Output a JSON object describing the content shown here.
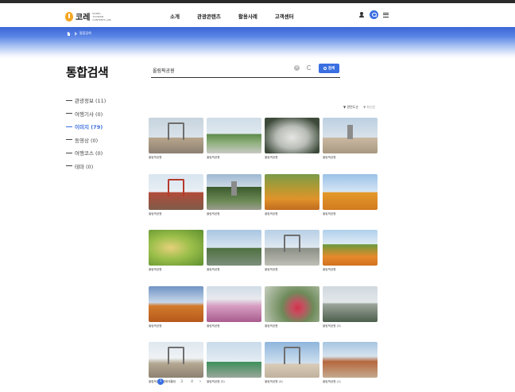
{
  "header": {
    "logo_text": "코레",
    "logo_sub": "KOREA TOURISM CONTENTS LAB",
    "nav": [
      "소개",
      "관광콘텐츠",
      "활용사례",
      "고객센터"
    ]
  },
  "breadcrumb": {
    "current": "통합검색"
  },
  "page_title": "통합검색",
  "search": {
    "value": "올림픽공원",
    "button_label": "검색"
  },
  "sidebar": {
    "items": [
      {
        "label": "관광정보 (11)",
        "active": false
      },
      {
        "label": "여행기사 (0)",
        "active": false
      },
      {
        "label": "이미지 (79)",
        "active": true
      },
      {
        "label": "동영상 (0)",
        "active": false
      },
      {
        "label": "여행코스 (0)",
        "active": false
      },
      {
        "label": "테마 (0)",
        "active": false
      }
    ]
  },
  "sort": {
    "primary": "▼ 관련도순",
    "secondary": "▼ 최신순"
  },
  "images": [
    {
      "caption": "올림픽공원",
      "scene": "t1"
    },
    {
      "caption": "올림픽공원",
      "scene": "t2"
    },
    {
      "caption": "올림픽공원",
      "scene": "t3"
    },
    {
      "caption": "올림픽공원",
      "scene": "t4"
    },
    {
      "caption": "올림픽공원",
      "scene": "t5"
    },
    {
      "caption": "올림픽공원",
      "scene": "t6"
    },
    {
      "caption": "올림픽공원",
      "scene": "t7"
    },
    {
      "caption": "올림픽공원",
      "scene": "t8"
    },
    {
      "caption": "올림픽공원",
      "scene": "t9"
    },
    {
      "caption": "올림픽공원",
      "scene": "t10"
    },
    {
      "caption": "올림픽공원",
      "scene": "t11"
    },
    {
      "caption": "올림픽공원",
      "scene": "t12"
    },
    {
      "caption": "올림픽공원",
      "scene": "t13"
    },
    {
      "caption": "올림픽공원",
      "scene": "t14"
    },
    {
      "caption": "올림픽공원",
      "scene": "t15"
    },
    {
      "caption": "올림픽공원 (3)",
      "scene": "t16"
    },
    {
      "caption": "올림픽공원 평화의광장",
      "scene": "t17"
    },
    {
      "caption": "올림픽공원 (5)",
      "scene": "t18"
    },
    {
      "caption": "올림픽공원 (4)",
      "scene": "t19"
    },
    {
      "caption": "올림픽공원 (1)",
      "scene": "t20"
    }
  ],
  "pagination": {
    "prev": "‹",
    "pages": [
      "1",
      "2",
      "3",
      "4"
    ],
    "current": "1",
    "next": "›"
  },
  "colors": {
    "accent": "#3a6fe2",
    "logo": "#f5a623"
  },
  "icons": [
    "user-icon",
    "search-icon",
    "menu-icon",
    "home-icon",
    "clear-icon",
    "refresh-icon"
  ]
}
